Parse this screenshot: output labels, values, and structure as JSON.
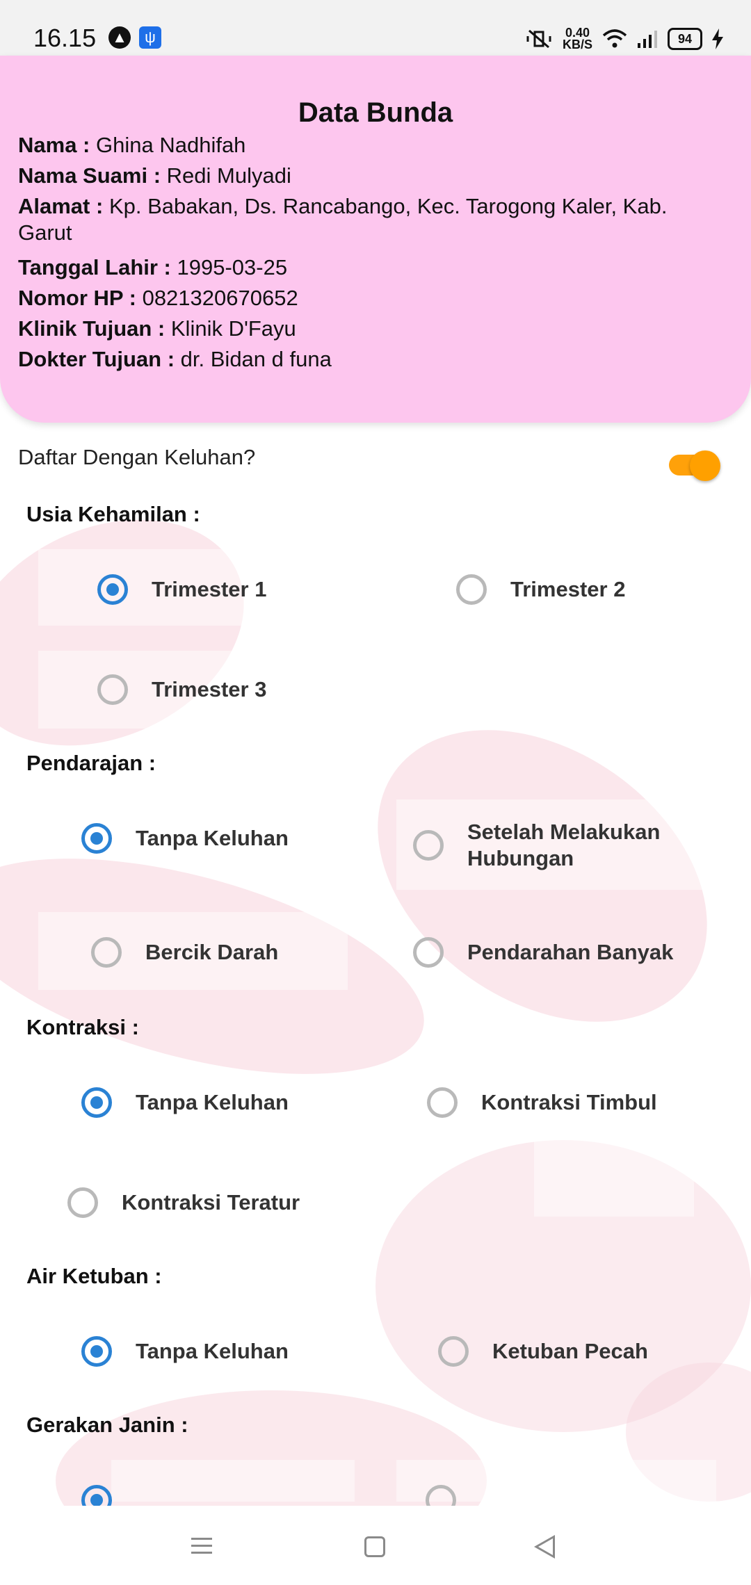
{
  "status_bar": {
    "time": "16.15",
    "speed_value": "0.40",
    "speed_unit": "KB/S",
    "battery": "94"
  },
  "header": {
    "title": "Data Bunda",
    "fields": [
      {
        "label": "Nama :",
        "value": "Ghina Nadhifah"
      },
      {
        "label": "Nama Suami :",
        "value": "Redi Mulyadi"
      },
      {
        "label": "Alamat :",
        "value": "Kp. Babakan, Ds. Rancabango, Kec. Tarogong Kaler, Kab. Garut"
      },
      {
        "label": "Tanggal Lahir :",
        "value": "1995-03-25"
      },
      {
        "label": "Nomor HP :",
        "value": "0821320670652"
      },
      {
        "label": "Klinik Tujuan :",
        "value": "Klinik D'Fayu"
      },
      {
        "label": "Dokter Tujuan :",
        "value": "dr. Bidan d funa"
      }
    ]
  },
  "complaint_toggle": {
    "label": "Daftar Dengan Keluhan?",
    "on": true
  },
  "sections": {
    "usia": {
      "title": "Usia Kehamilan :",
      "options": [
        "Trimester 1",
        "Trimester 2",
        "Trimester 3"
      ],
      "selected": "Trimester 1"
    },
    "pendarahan": {
      "title": "Pendarajan :",
      "options": [
        "Tanpa Keluhan",
        "Setelah Melakukan Hubungan",
        "Bercik Darah",
        "Pendarahan Banyak"
      ],
      "selected": "Tanpa Keluhan"
    },
    "kontraksi": {
      "title": "Kontraksi :",
      "options": [
        "Tanpa Keluhan",
        "Kontraksi Timbul",
        "Kontraksi Teratur"
      ],
      "selected": "Tanpa Keluhan"
    },
    "ketuban": {
      "title": "Air Ketuban :",
      "options": [
        "Tanpa Keluhan",
        "Ketuban Pecah"
      ],
      "selected": "Tanpa Keluhan"
    },
    "janin": {
      "title": "Gerakan Janin :"
    }
  },
  "colors": {
    "header_bg": "#fdc6ee",
    "accent_radio": "#2a82d4",
    "toggle": "#ffa000"
  }
}
